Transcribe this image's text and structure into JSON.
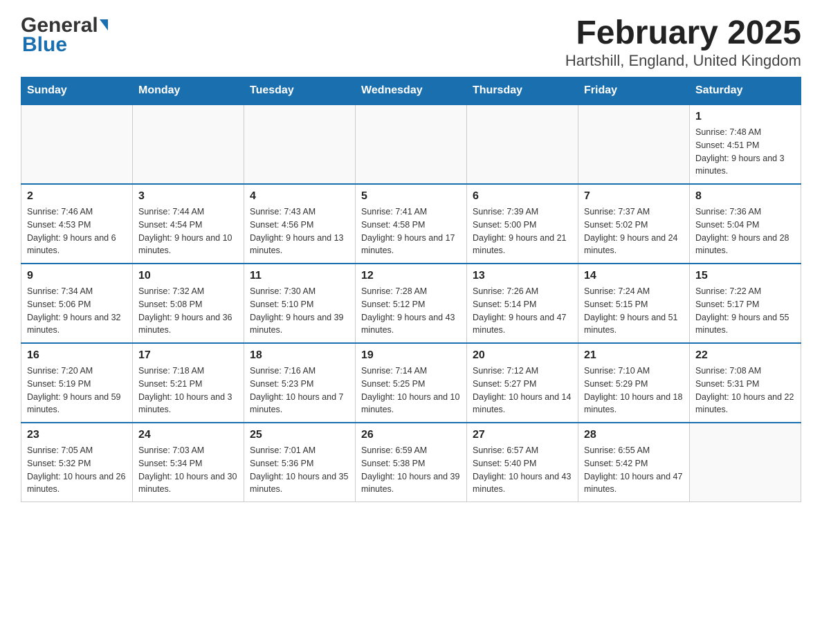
{
  "header": {
    "logo_general": "General",
    "logo_blue": "Blue",
    "title": "February 2025",
    "subtitle": "Hartshill, England, United Kingdom"
  },
  "calendar": {
    "days_of_week": [
      "Sunday",
      "Monday",
      "Tuesday",
      "Wednesday",
      "Thursday",
      "Friday",
      "Saturday"
    ],
    "weeks": [
      [
        {
          "day": "",
          "info": ""
        },
        {
          "day": "",
          "info": ""
        },
        {
          "day": "",
          "info": ""
        },
        {
          "day": "",
          "info": ""
        },
        {
          "day": "",
          "info": ""
        },
        {
          "day": "",
          "info": ""
        },
        {
          "day": "1",
          "info": "Sunrise: 7:48 AM\nSunset: 4:51 PM\nDaylight: 9 hours and 3 minutes."
        }
      ],
      [
        {
          "day": "2",
          "info": "Sunrise: 7:46 AM\nSunset: 4:53 PM\nDaylight: 9 hours and 6 minutes."
        },
        {
          "day": "3",
          "info": "Sunrise: 7:44 AM\nSunset: 4:54 PM\nDaylight: 9 hours and 10 minutes."
        },
        {
          "day": "4",
          "info": "Sunrise: 7:43 AM\nSunset: 4:56 PM\nDaylight: 9 hours and 13 minutes."
        },
        {
          "day": "5",
          "info": "Sunrise: 7:41 AM\nSunset: 4:58 PM\nDaylight: 9 hours and 17 minutes."
        },
        {
          "day": "6",
          "info": "Sunrise: 7:39 AM\nSunset: 5:00 PM\nDaylight: 9 hours and 21 minutes."
        },
        {
          "day": "7",
          "info": "Sunrise: 7:37 AM\nSunset: 5:02 PM\nDaylight: 9 hours and 24 minutes."
        },
        {
          "day": "8",
          "info": "Sunrise: 7:36 AM\nSunset: 5:04 PM\nDaylight: 9 hours and 28 minutes."
        }
      ],
      [
        {
          "day": "9",
          "info": "Sunrise: 7:34 AM\nSunset: 5:06 PM\nDaylight: 9 hours and 32 minutes."
        },
        {
          "day": "10",
          "info": "Sunrise: 7:32 AM\nSunset: 5:08 PM\nDaylight: 9 hours and 36 minutes."
        },
        {
          "day": "11",
          "info": "Sunrise: 7:30 AM\nSunset: 5:10 PM\nDaylight: 9 hours and 39 minutes."
        },
        {
          "day": "12",
          "info": "Sunrise: 7:28 AM\nSunset: 5:12 PM\nDaylight: 9 hours and 43 minutes."
        },
        {
          "day": "13",
          "info": "Sunrise: 7:26 AM\nSunset: 5:14 PM\nDaylight: 9 hours and 47 minutes."
        },
        {
          "day": "14",
          "info": "Sunrise: 7:24 AM\nSunset: 5:15 PM\nDaylight: 9 hours and 51 minutes."
        },
        {
          "day": "15",
          "info": "Sunrise: 7:22 AM\nSunset: 5:17 PM\nDaylight: 9 hours and 55 minutes."
        }
      ],
      [
        {
          "day": "16",
          "info": "Sunrise: 7:20 AM\nSunset: 5:19 PM\nDaylight: 9 hours and 59 minutes."
        },
        {
          "day": "17",
          "info": "Sunrise: 7:18 AM\nSunset: 5:21 PM\nDaylight: 10 hours and 3 minutes."
        },
        {
          "day": "18",
          "info": "Sunrise: 7:16 AM\nSunset: 5:23 PM\nDaylight: 10 hours and 7 minutes."
        },
        {
          "day": "19",
          "info": "Sunrise: 7:14 AM\nSunset: 5:25 PM\nDaylight: 10 hours and 10 minutes."
        },
        {
          "day": "20",
          "info": "Sunrise: 7:12 AM\nSunset: 5:27 PM\nDaylight: 10 hours and 14 minutes."
        },
        {
          "day": "21",
          "info": "Sunrise: 7:10 AM\nSunset: 5:29 PM\nDaylight: 10 hours and 18 minutes."
        },
        {
          "day": "22",
          "info": "Sunrise: 7:08 AM\nSunset: 5:31 PM\nDaylight: 10 hours and 22 minutes."
        }
      ],
      [
        {
          "day": "23",
          "info": "Sunrise: 7:05 AM\nSunset: 5:32 PM\nDaylight: 10 hours and 26 minutes."
        },
        {
          "day": "24",
          "info": "Sunrise: 7:03 AM\nSunset: 5:34 PM\nDaylight: 10 hours and 30 minutes."
        },
        {
          "day": "25",
          "info": "Sunrise: 7:01 AM\nSunset: 5:36 PM\nDaylight: 10 hours and 35 minutes."
        },
        {
          "day": "26",
          "info": "Sunrise: 6:59 AM\nSunset: 5:38 PM\nDaylight: 10 hours and 39 minutes."
        },
        {
          "day": "27",
          "info": "Sunrise: 6:57 AM\nSunset: 5:40 PM\nDaylight: 10 hours and 43 minutes."
        },
        {
          "day": "28",
          "info": "Sunrise: 6:55 AM\nSunset: 5:42 PM\nDaylight: 10 hours and 47 minutes."
        },
        {
          "day": "",
          "info": ""
        }
      ]
    ]
  }
}
